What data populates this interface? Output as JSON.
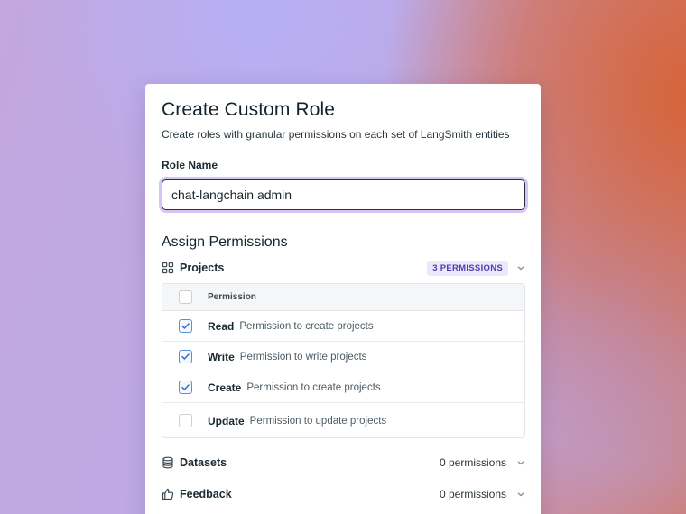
{
  "dialog": {
    "title": "Create Custom Role",
    "subtitle": "Create roles with granular permissions on each set of LangSmith entities",
    "role_name_label": "Role Name",
    "role_name_value": "chat-langchain admin",
    "assign_title": "Assign Permissions"
  },
  "groups": {
    "projects": {
      "label": "Projects",
      "icon": "grid-icon",
      "badge": "3 PERMISSIONS",
      "table": {
        "header": "Permission",
        "rows": [
          {
            "name": "Read",
            "description": "Permission to create projects",
            "checked": true
          },
          {
            "name": "Write",
            "description": "Permission to write projects",
            "checked": true
          },
          {
            "name": "Create",
            "description": "Permission to create projects",
            "checked": true
          },
          {
            "name": "Update",
            "description": "Permission to update projects",
            "checked": false
          }
        ]
      }
    },
    "datasets": {
      "label": "Datasets",
      "icon": "database-icon",
      "count": "0 permissions"
    },
    "feedback": {
      "label": "Feedback",
      "icon": "thumbs-up-icon",
      "count": "0 permissions"
    }
  },
  "colors": {
    "checkbox_accent": "#5b8fd6",
    "badge_text": "#4a3fb0",
    "badge_bg": "#ebe8fb",
    "focus_ring": "#b096ee"
  }
}
